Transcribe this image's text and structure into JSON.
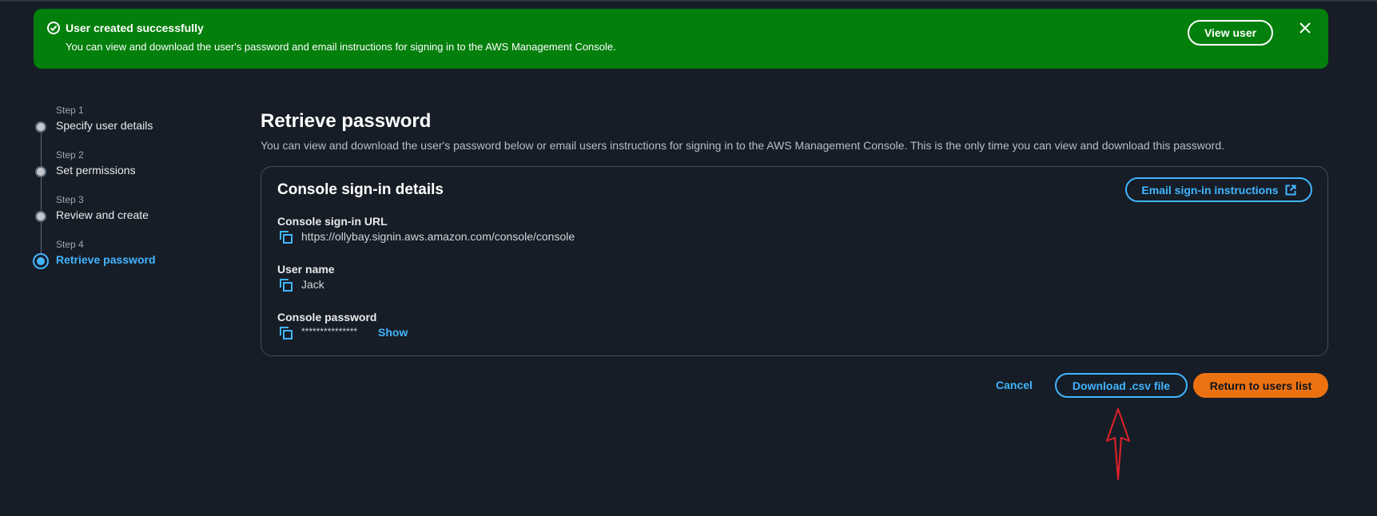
{
  "flash": {
    "title": "User created successfully",
    "message": "You can view and download the user's password and email instructions for signing in to the AWS Management Console.",
    "view_user_label": "View user",
    "icon": "check-circle-icon",
    "close_icon": "close-icon",
    "color": "#037f0c"
  },
  "stepper": {
    "steps": [
      {
        "label": "Step 1",
        "title": "Specify user details",
        "active": false
      },
      {
        "label": "Step 2",
        "title": "Set permissions",
        "active": false
      },
      {
        "label": "Step 3",
        "title": "Review and create",
        "active": false
      },
      {
        "label": "Step 4",
        "title": "Retrieve password",
        "active": true
      }
    ]
  },
  "main": {
    "title": "Retrieve password",
    "description": "You can view and download the user's password below or email users instructions for signing in to the AWS Management Console. This is the only time you can view and download this password."
  },
  "details": {
    "title": "Console sign-in details",
    "email_button_label": "Email sign-in instructions",
    "email_icon": "external-link-icon",
    "url_label": "Console sign-in URL",
    "url_value": "https://ollybay.signin.aws.amazon.com/console/console",
    "username_label": "User name",
    "username_value": "Jack",
    "password_label": "Console password",
    "password_value": "***************",
    "show_label": "Show",
    "copy_icon": "copy-icon"
  },
  "actions": {
    "cancel_label": "Cancel",
    "download_label": "Download .csv file",
    "return_label": "Return to users list"
  },
  "colors": {
    "background": "#161d26",
    "link": "#42b4ff",
    "primary_button": "#ec7211",
    "annotation": "#e0202a"
  }
}
